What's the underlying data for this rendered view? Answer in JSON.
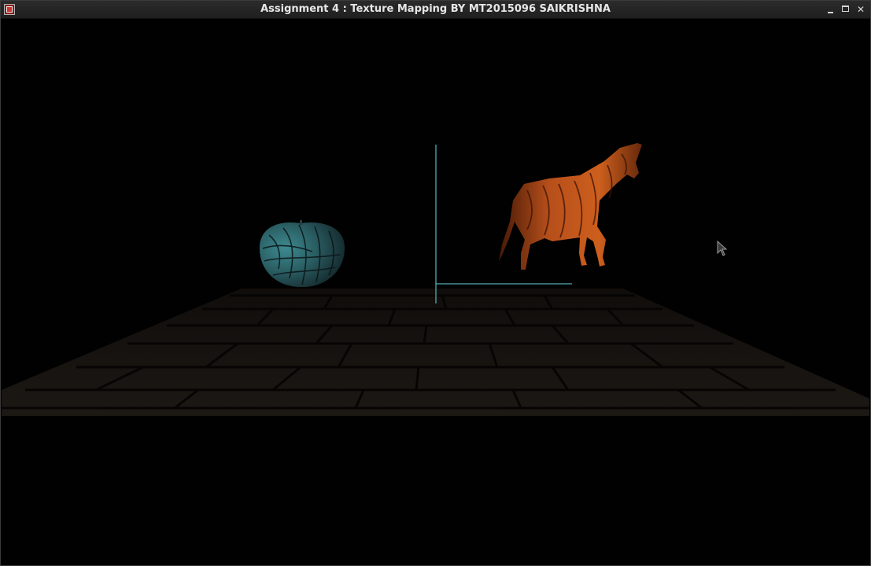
{
  "window": {
    "title": "Assignment 4 : Texture Mapping BY MT2015096 SAIKRISHNA",
    "controls": {
      "minimize": "minimize",
      "maximize": "maximize",
      "close": "close"
    }
  },
  "scene": {
    "background": "#010101",
    "floor_color": "#1a1612",
    "floor_mortar_color": "#060504",
    "apple_color": "#2f6f74",
    "horse_color": "#b5471a",
    "axis_color": "#5fc9d4"
  },
  "icons": {
    "app": "app-window-icon",
    "cursor": "mouse-pointer-icon"
  }
}
